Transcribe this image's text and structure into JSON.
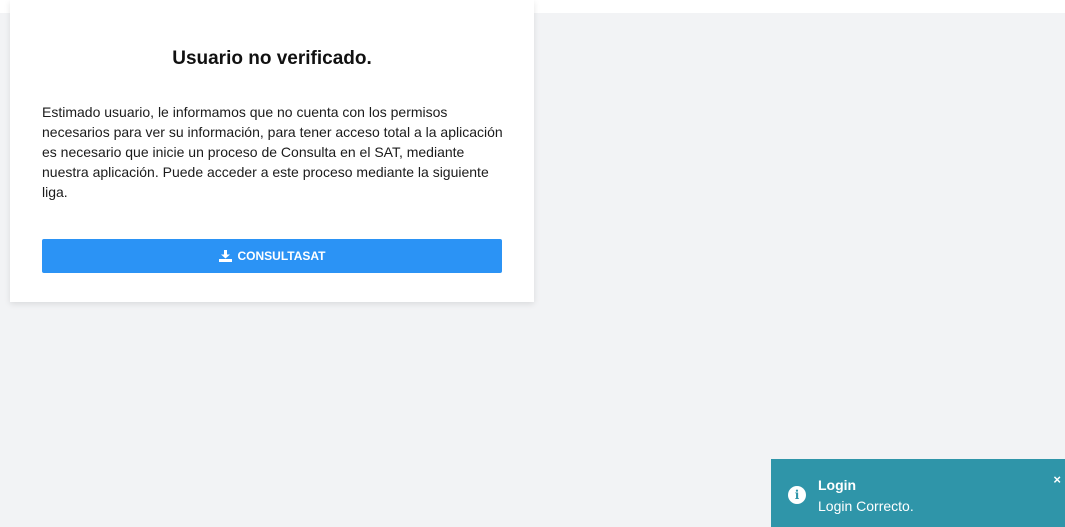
{
  "card": {
    "title": "Usuario no verificado.",
    "message": "Estimado usuario, le informamos que no cuenta con los permisos necesarios para ver su información, para tener acceso total a la aplicación es necesario que inicie un proceso de Consulta en el SAT, mediante nuestra aplicación. Puede acceder a este proceso mediante la siguiente liga.",
    "button_label": "CONSULTASAT",
    "button_icon": "download-icon"
  },
  "toast": {
    "icon": "info-icon",
    "title": "Login",
    "message": "Login Correcto.",
    "close_glyph": "×"
  },
  "colors": {
    "background": "#f2f3f5",
    "card": "#ffffff",
    "button": "#2b93f5",
    "toast": "#2f95a9"
  }
}
